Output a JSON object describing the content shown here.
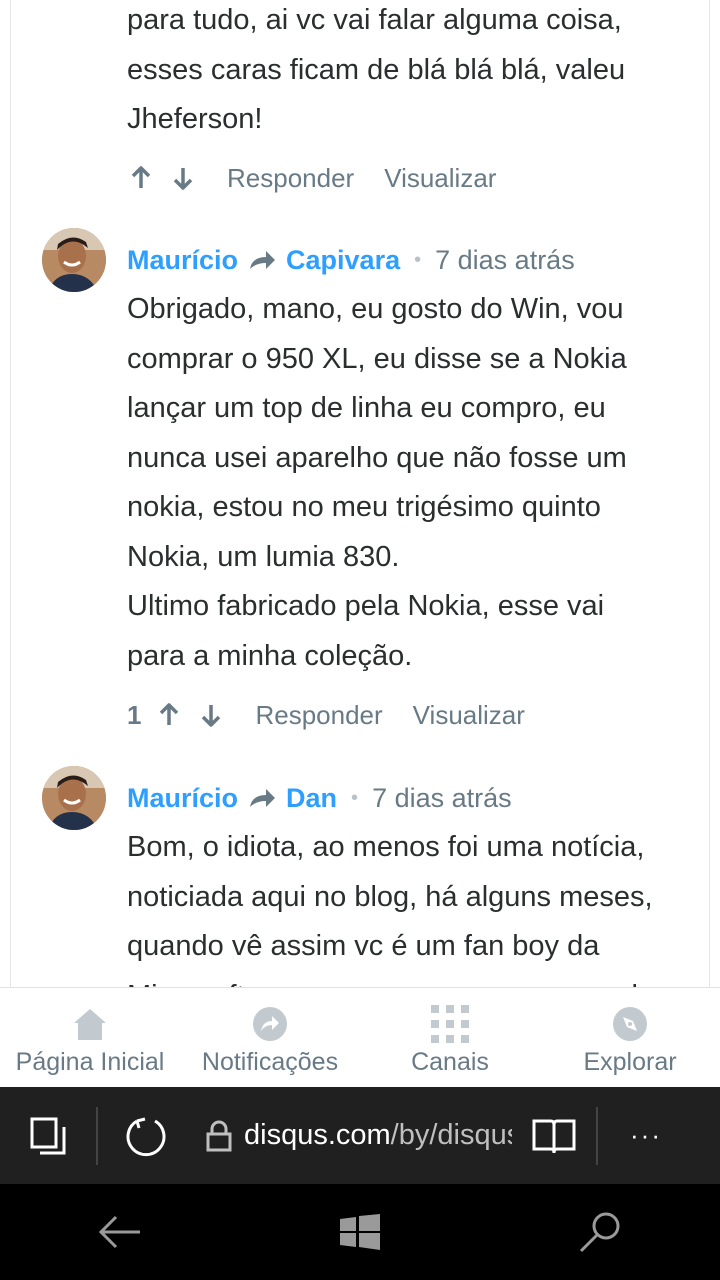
{
  "comments": [
    {
      "text_lines": [
        "para tudo, ai vc vai falar alguma coisa,",
        "esses caras ficam de blá blá blá, valeu",
        "Jheferson!"
      ],
      "vote_count": "",
      "reply_label": "Responder",
      "view_label": "Visualizar"
    },
    {
      "author": "Maurício",
      "reply_to": "Capivara",
      "time": "7 dias atrás",
      "text_lines": [
        "Obrigado, mano, eu gosto do Win, vou",
        "comprar o 950 XL, eu disse se a Nokia",
        "lançar um top de linha eu compro, eu",
        "nunca usei aparelho que não fosse um",
        "nokia, estou no meu trigésimo quinto",
        "Nokia, um lumia 830.",
        "Ultimo fabricado pela Nokia, esse vai",
        "para a minha coleção."
      ],
      "vote_count": "1",
      "reply_label": "Responder",
      "view_label": "Visualizar"
    },
    {
      "author": "Maurício",
      "reply_to": "Dan",
      "time": "7 dias atrás",
      "text_lines": [
        "Bom, o idiota, ao menos foi uma notícia,",
        "noticiada aqui no blog, há alguns meses,",
        "quando vê assim vc é um fan boy da",
        "Microsoft, esses caras que veem que ele"
      ]
    }
  ],
  "dot_separator": "•",
  "app_nav": [
    {
      "label": "Página Inicial",
      "icon": "home-icon"
    },
    {
      "label": "Notificações",
      "icon": "notification-share-icon"
    },
    {
      "label": "Canais",
      "icon": "grid-icon"
    },
    {
      "label": "Explorar",
      "icon": "compass-icon"
    }
  ],
  "browser": {
    "url_main": "disqus.com",
    "url_path": "/by/disqus",
    "more_label": "···"
  },
  "colors": {
    "accent": "#2e9fff",
    "text": "#2a2e2e",
    "muted": "#687a86"
  }
}
